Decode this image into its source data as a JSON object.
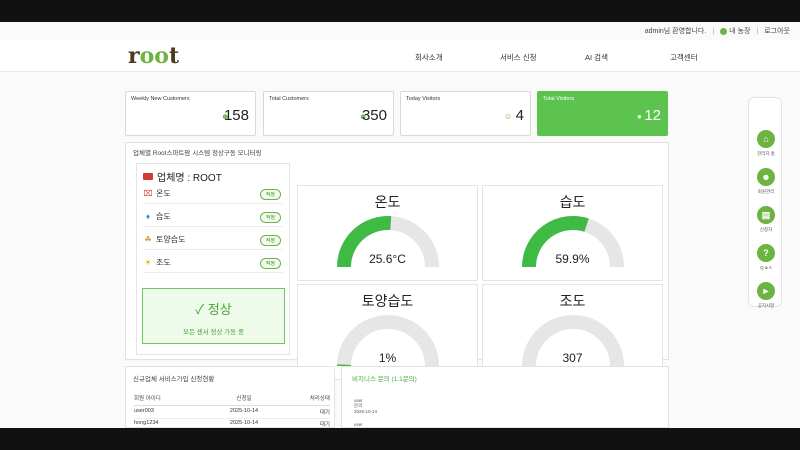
{
  "util": {
    "welcome": "admin님 환영합니다.",
    "myfarm": "내 농장",
    "logout": "로그아웃"
  },
  "header": {
    "logo_r": "r",
    "logo_oo": "oo",
    "logo_t": "t"
  },
  "nav": [
    "회사소개",
    "서비스 신청",
    "AI 검색",
    "고객센터"
  ],
  "stats": [
    {
      "label": "Weekly New Customers",
      "value": "158",
      "icon": "user-plus-icon"
    },
    {
      "label": "Total Customers",
      "value": "350",
      "icon": "users-icon"
    },
    {
      "label": "Today Visitors",
      "value": "4",
      "icon": "user-circle-icon"
    },
    {
      "label": "Total Visitors",
      "value": "12",
      "icon": "footprints-icon"
    }
  ],
  "monitor": {
    "title": "업체별 Root스마트팜 시스템 정상구동 모니터링",
    "farm_label": "업체명 : ROOT",
    "sensors": [
      {
        "name": "온도",
        "badge": "적정",
        "icon": "thermometer-icon"
      },
      {
        "name": "습도",
        "badge": "적정",
        "icon": "droplet-icon"
      },
      {
        "name": "토양습도",
        "badge": "적정",
        "icon": "plant-icon"
      },
      {
        "name": "조도",
        "badge": "적정",
        "icon": "sun-icon"
      }
    ],
    "ok_title": "✓ 정상",
    "ok_sub": "모든 센서 정상 가동 중",
    "gauges": [
      {
        "title": "온도",
        "value": "25.6°C",
        "fill": 0.52
      },
      {
        "title": "습도",
        "value": "59.9%",
        "fill": 0.6
      },
      {
        "title": "토양습도",
        "value": "1%",
        "fill": 0.01
      },
      {
        "title": "조도",
        "value": "307",
        "fill": 0.0
      }
    ],
    "colors": {
      "fill": "#3fba45",
      "track": "#e6e6e6"
    }
  },
  "signup": {
    "title": "신규업체 서비스가입 신청현황",
    "columns": [
      "회원 아이디",
      "신청일",
      "처리상태"
    ],
    "rows": [
      [
        "user003",
        "2025-10-14",
        "대기"
      ],
      [
        "hong1234",
        "2025-10-14",
        "대기"
      ]
    ]
  },
  "inquiry": {
    "title": "비지니스 문의 (1:1문의)",
    "items": [
      {
        "line1": "user",
        "line2": "문의",
        "line3": "2025-10-14"
      },
      {
        "line1": "user",
        "line2": "",
        "line3": ""
      }
    ]
  },
  "quick": [
    {
      "label": "관리자 홈",
      "icon": "home-icon"
    },
    {
      "label": "회원관리",
      "icon": "person-icon"
    },
    {
      "label": "신청자",
      "icon": "clipboard-icon"
    },
    {
      "label": "Q & A",
      "icon": "question-icon"
    },
    {
      "label": "공지사항",
      "icon": "megaphone-icon"
    }
  ]
}
